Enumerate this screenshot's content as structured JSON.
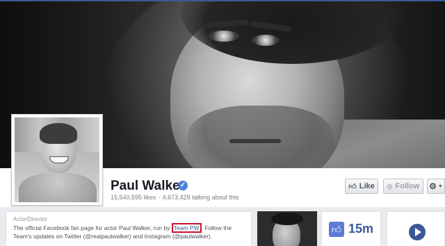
{
  "page": {
    "name": "Paul Walker",
    "verified_icon": "verified-check-icon",
    "likes_text": "15,540,595 likes",
    "separator": "·",
    "talking_text": "4,673,429 talking about this"
  },
  "actions": {
    "like_label": "Like",
    "follow_label": "Follow",
    "like_icon": "thumbs-up-icon",
    "follow_icon": "rss-icon",
    "settings_icon": "gear-icon"
  },
  "about": {
    "category": "Actor/Director",
    "text_before": "The official Facebook fan page for actor Paul Walker, run by ",
    "highlight": "Team PW",
    "text_after": ". Follow the Team's updates on Twitter (@realpaulwalker) and Instagram (@paulwalker).",
    "highlight_color": "#c8102e"
  },
  "likes_card": {
    "count": "15m",
    "icon": "thumbs-up-icon"
  },
  "video_card": {
    "icon": "play-icon"
  },
  "colors": {
    "facebook_blue": "#3b5998",
    "background_gray": "#e9ebee"
  }
}
